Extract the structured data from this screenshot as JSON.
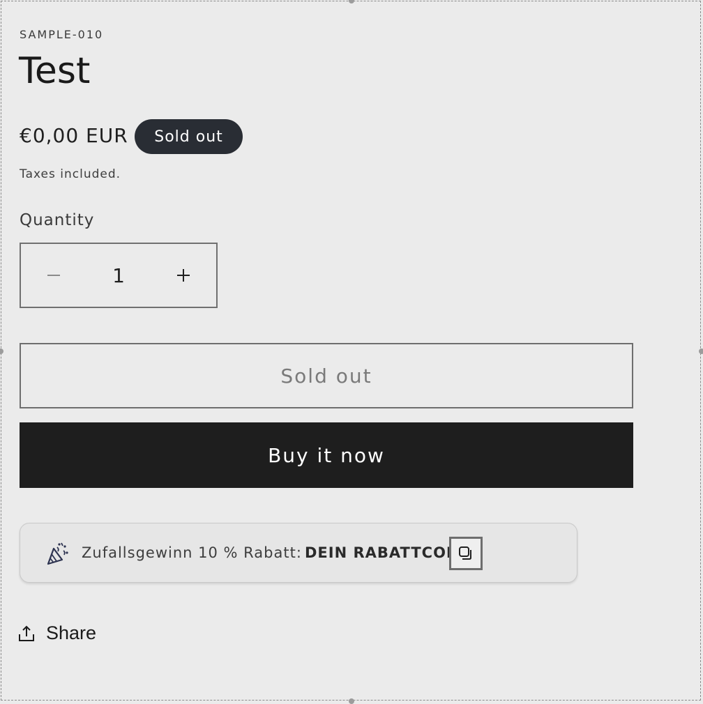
{
  "product": {
    "sku": "SAMPLE-010",
    "title": "Test",
    "price": "€0,00 EUR",
    "badge": "Sold out",
    "tax_note": "Taxes included."
  },
  "quantity": {
    "label": "Quantity",
    "value": "1",
    "decrease_symbol": "−",
    "increase_symbol": "+"
  },
  "actions": {
    "soldout_label": "Sold out",
    "buy_label": "Buy it now"
  },
  "promo": {
    "text": "Zufallsgewinn 10 % Rabatt:",
    "code": "DEIN RABATTCODE",
    "icon": "party-popper-icon",
    "copy_icon": "copy-icon"
  },
  "share": {
    "label": "Share",
    "icon": "share-icon"
  }
}
